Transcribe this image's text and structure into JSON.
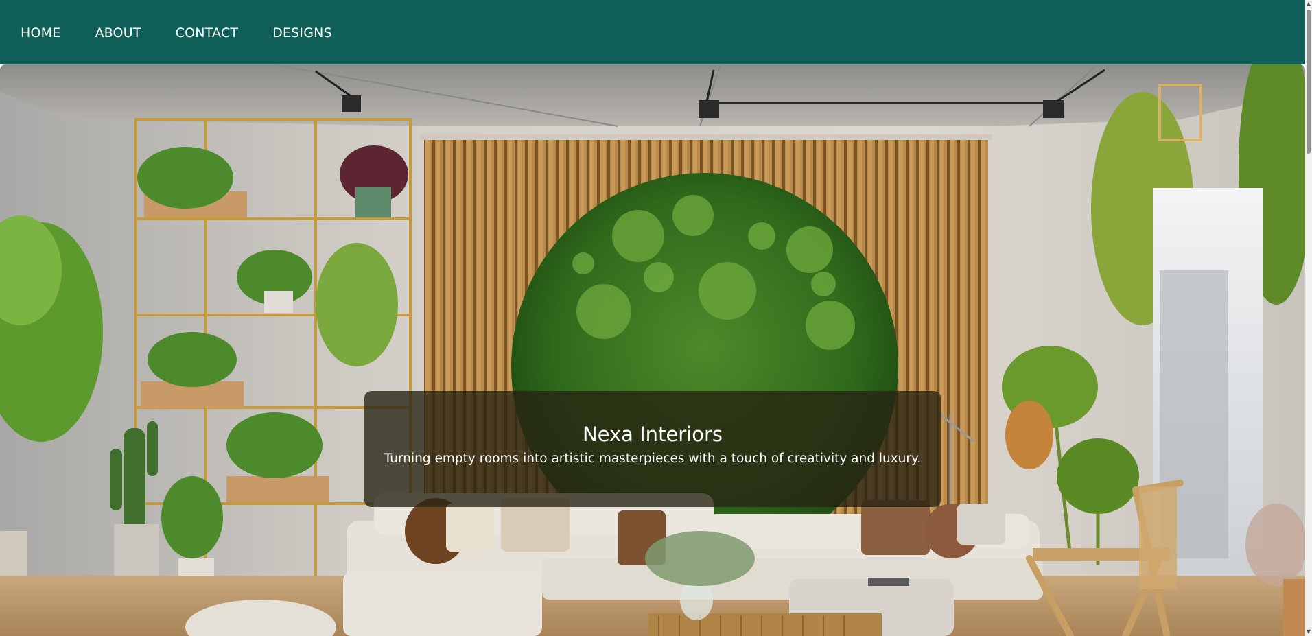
{
  "nav": {
    "items": [
      {
        "label": "HOME"
      },
      {
        "label": "ABOUT"
      },
      {
        "label": "CONTACT"
      },
      {
        "label": "DESIGNS"
      }
    ]
  },
  "hero": {
    "title": "Nexa Interiors",
    "subtitle": "Turning empty rooms into artistic masterpieces with a touch of creativity and luxury."
  },
  "colors": {
    "nav_background": "#0f5e57",
    "nav_text": "#ffffff",
    "card_background": "rgba(38,34,18,0.78)",
    "card_text": "#ffffff"
  },
  "icons": {
    "scroll_up": "scroll-up-arrow-icon",
    "scroll_down": "scroll-down-arrow-icon"
  }
}
